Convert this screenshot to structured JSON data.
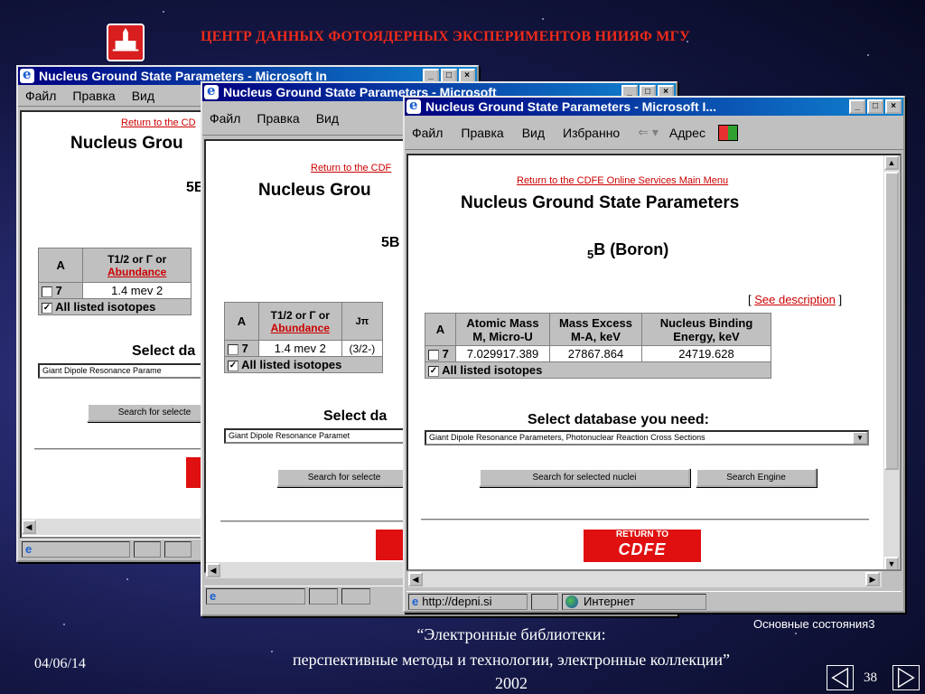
{
  "header": {
    "org_title": "ЦЕНТР ДАННЫХ ФОТОЯДЕРНЫХ ЭКСПЕРИМЕНТОВ НИИЯФ МГУ"
  },
  "window_back": {
    "title": "Nucleus Ground State Parameters - Microsoft In",
    "menu": [
      "Файл",
      "Правка",
      "Вид"
    ],
    "return_link": "Return to the CD",
    "page_title": "Nucleus Grou",
    "nucleus": "5B",
    "table": {
      "col_a": "A",
      "col_t": "T1/2 or Γ or",
      "col_abundance": "Abundance",
      "row_a": "7",
      "row_value": "1.4 mev 2",
      "all_listed": "All listed isotopes"
    },
    "select_label": "Select da",
    "select_value": "Giant Dipole Resonance Parame",
    "search_button": "Search for selecte",
    "status_icon": "e"
  },
  "window_mid": {
    "title": "Nucleus Ground State Parameters - Microsoft",
    "menu": [
      "Файл",
      "Правка",
      "Вид"
    ],
    "return_link": "Return to the CDF",
    "page_title": "Nucleus Grou",
    "nucleus": "5B",
    "table": {
      "col_a": "A",
      "col_t": "T1/2 or Γ or",
      "col_abundance": "Abundance",
      "col_j": "Jπ",
      "row_a": "7",
      "row_value": "1.4 mev 2",
      "row_j": "(3/2-)",
      "all_listed": "All listed isotopes"
    },
    "select_label": "Select da",
    "select_value": "Giant Dipole Resonance Paramet",
    "search_button": "Search for selecte"
  },
  "window_front": {
    "title": "Nucleus Ground State Parameters - Microsoft I...",
    "menu": [
      "Файл",
      "Правка",
      "Вид",
      "Избранно"
    ],
    "address_label": "Адрес",
    "return_link": "Return to the CDFE Online Services Main Menu",
    "page_title": "Nucleus Ground State Parameters",
    "nucleus_sub": "5",
    "nucleus_main": "B (Boron)",
    "see_description": "See description",
    "table": {
      "col_a": "A",
      "col_mass": "Atomic Mass M, Micro-U",
      "col_excess": "Mass Excess M-A, keV",
      "col_binding": "Nucleus Binding Energy, keV",
      "row_a": "7",
      "row_mass": "7.029917.389",
      "row_excess": "27867.864",
      "row_binding": "24719.628",
      "all_listed": "All listed isotopes"
    },
    "select_label": "Select database you need:",
    "select_value": "Giant Dipole Resonance Parameters, Photonuclear Reaction Cross Sections",
    "search_button": "Search for selected nuclei",
    "engine_button": "Search Engine",
    "cdfe_top": "RETURN TO",
    "cdfe_main": "CDFE",
    "status_url": "http://depni.si",
    "status_zone": "Интернет"
  },
  "footer": {
    "caption_right": "Основные состояния3",
    "line1": "“Электронные библиотеки:",
    "line2": "перспективные методы и технологии, электронные коллекции”",
    "year": "2002",
    "date": "04/06/14",
    "page_number": "38"
  }
}
